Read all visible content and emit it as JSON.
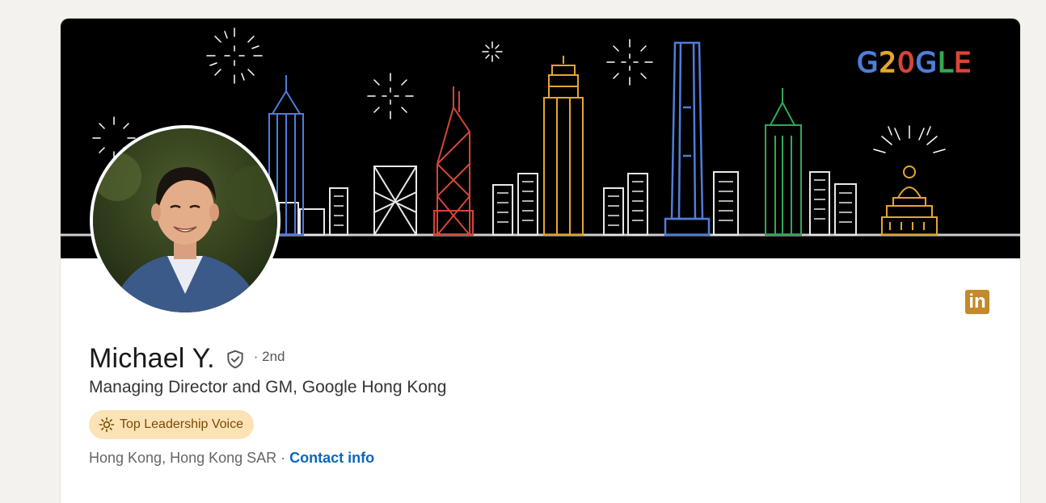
{
  "banner": {
    "logo": {
      "text": "G20GLE",
      "letters": [
        {
          "char": "G",
          "color": "#4f7ddb"
        },
        {
          "char": "2",
          "color": "#e3a72c"
        },
        {
          "char": "0",
          "color": "#d44638"
        },
        {
          "char": "G",
          "color": "#4f7ddb"
        },
        {
          "char": "L",
          "color": "#34a853"
        },
        {
          "char": "E",
          "color": "#db4437"
        }
      ]
    }
  },
  "profile": {
    "name": "Michael Y.",
    "degree": "· 2nd",
    "headline": "Managing Director and GM, Google Hong Kong",
    "badge_label": "Top Leadership Voice",
    "location": "Hong Kong, Hong Kong SAR",
    "separator": " · ",
    "contact_label": "Contact info",
    "linkedin_label": "in"
  },
  "colors": {
    "background": "#f3f2ef",
    "link": "#0a66c2",
    "badge_bg": "#fbe3b6",
    "badge_text": "#7a4a05",
    "linkedin_gold": "#c3892a"
  }
}
